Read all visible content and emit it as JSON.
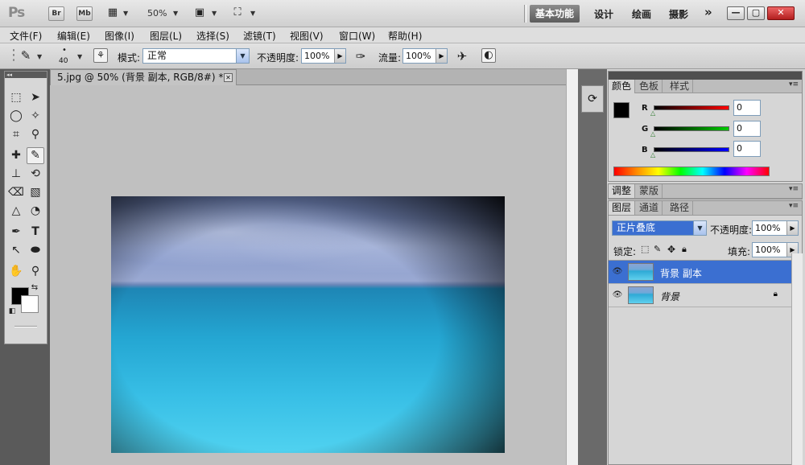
{
  "app": {
    "logo": "Ps",
    "bridge_label": "Br",
    "minibridge_label": "Mb",
    "zoom": "50%",
    "workspaces": [
      "基本功能",
      "设计",
      "绘画",
      "摄影"
    ],
    "more": "»",
    "window_buttons": [
      "—",
      "▢",
      "✕"
    ]
  },
  "menu": [
    "文件(F)",
    "编辑(E)",
    "图像(I)",
    "图层(L)",
    "选择(S)",
    "滤镜(T)",
    "视图(V)",
    "窗口(W)",
    "帮助(H)"
  ],
  "options": {
    "brush_size": "40",
    "mode_label": "模式:",
    "mode_value": "正常",
    "opacity_label": "不透明度:",
    "opacity_value": "100%",
    "flow_label": "流量:",
    "flow_value": "100%"
  },
  "document": {
    "tab_title": "5.jpg @ 50% (背景 副本, RGB/8#) *",
    "close_glyph": "✕"
  },
  "color_panel": {
    "tabs": [
      "颜色",
      "色板",
      "样式"
    ],
    "r_label": "R",
    "g_label": "G",
    "b_label": "B",
    "r_value": "0",
    "g_value": "0",
    "b_value": "0",
    "foreground": "#000000",
    "background": "#ffffff"
  },
  "adjust_panel": {
    "tabs": [
      "调整",
      "蒙版"
    ]
  },
  "layers_panel": {
    "tabs": [
      "图层",
      "通道",
      "路径"
    ],
    "blend_mode": "正片叠底",
    "opacity_label": "不透明度:",
    "opacity_value": "100%",
    "lock_label": "锁定:",
    "fill_label": "填充:",
    "fill_value": "100%",
    "layers": [
      {
        "name": "背景 副本",
        "selected": true,
        "locked": false
      },
      {
        "name": "背景",
        "selected": false,
        "locked": true
      }
    ]
  },
  "colors": {
    "selection_blue": "#3b6fd1",
    "panel_bg": "#d6d6d6",
    "workspace_active": "#5c5c5c"
  }
}
